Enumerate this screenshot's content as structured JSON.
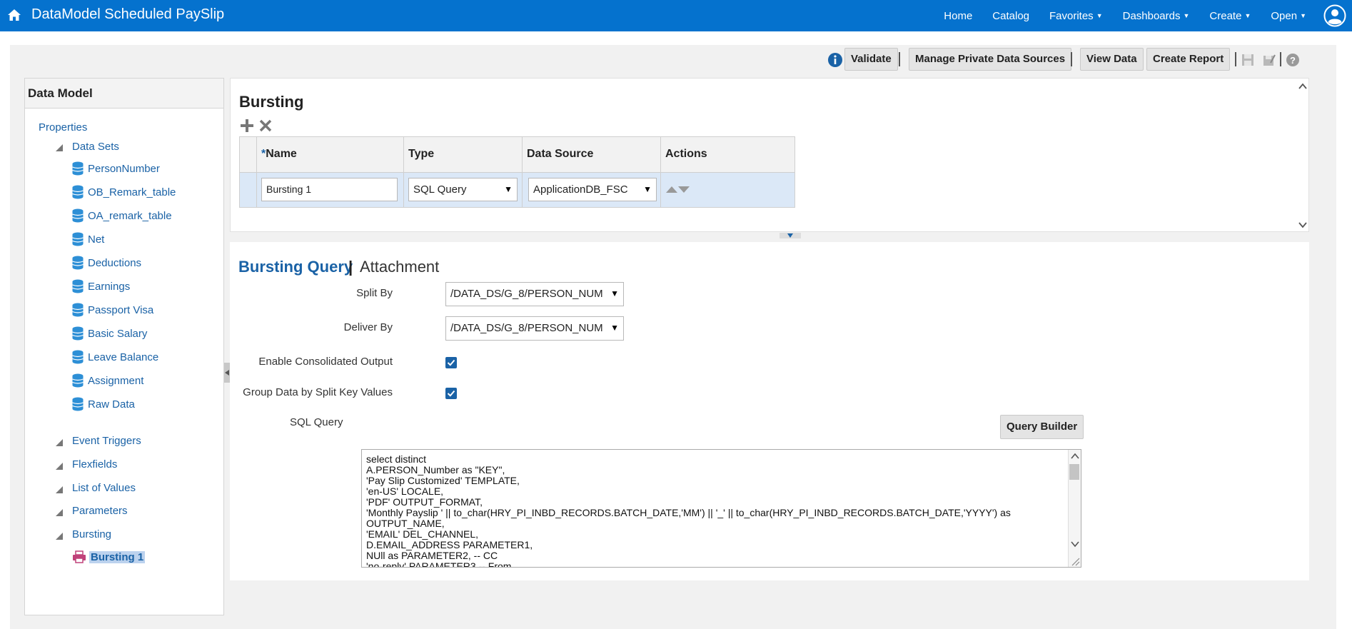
{
  "header": {
    "title": "DataModel Scheduled PaySlip",
    "nav": [
      "Home",
      "Catalog",
      "Favorites",
      "Dashboards",
      "Create",
      "Open"
    ]
  },
  "toolbar": {
    "validate": "Validate",
    "manage_sources": "Manage Private Data Sources",
    "view_data": "View Data",
    "create_report": "Create Report"
  },
  "sidebar": {
    "title": "Data Model",
    "properties": "Properties",
    "data_sets_label": "Data Sets",
    "data_sets": [
      "PersonNumber",
      "OB_Remark_table",
      "OA_remark_table",
      "Net",
      "Deductions",
      "Earnings",
      "Passport Visa",
      "Basic Salary",
      "Leave Balance",
      "Assignment",
      "Raw Data"
    ],
    "event_triggers": "Event Triggers",
    "flexfields": "Flexfields",
    "list_of_values": "List of Values",
    "parameters": "Parameters",
    "bursting": "Bursting",
    "bursting_child": "Bursting 1"
  },
  "bursting": {
    "title": "Bursting",
    "columns": {
      "required": "*",
      "name": "Name",
      "type": "Type",
      "data_source": "Data Source",
      "actions": "Actions"
    },
    "row": {
      "name": "Bursting 1",
      "type": "SQL Query",
      "data_source": "ApplicationDB_FSC"
    }
  },
  "query": {
    "tab_active": "Bursting Query",
    "tab_sep": "|",
    "tab_other": "Attachment",
    "split_by_label": "Split By",
    "split_by_value": "/DATA_DS/G_8/PERSON_NUM",
    "deliver_by_label": "Deliver By",
    "deliver_by_value": "/DATA_DS/G_8/PERSON_NUM",
    "consolidated_label": "Enable Consolidated Output",
    "group_label": "Group Data by Split Key Values",
    "sql_label": "SQL Query",
    "query_builder": "Query Builder",
    "sql_text": "select distinct\nA.PERSON_Number as \"KEY\",\n'Pay Slip Customized' TEMPLATE,\n'en-US' LOCALE,\n'PDF' OUTPUT_FORMAT,\n'Monthly Payslip ' || to_char(HRY_PI_INBD_RECORDS.BATCH_DATE,'MM') || '_' || to_char(HRY_PI_INBD_RECORDS.BATCH_DATE,'YYYY') as\nOUTPUT_NAME,\n'EMAIL' DEL_CHANNEL,\nD.EMAIL_ADDRESS PARAMETER1,\nNUll as PARAMETER2, -- CC\n'no-reply' PARAMETER3 -- From"
  },
  "colors": {
    "brand": "#0572ce",
    "link": "#1a62a6",
    "selected_row": "#dbe8f7"
  }
}
